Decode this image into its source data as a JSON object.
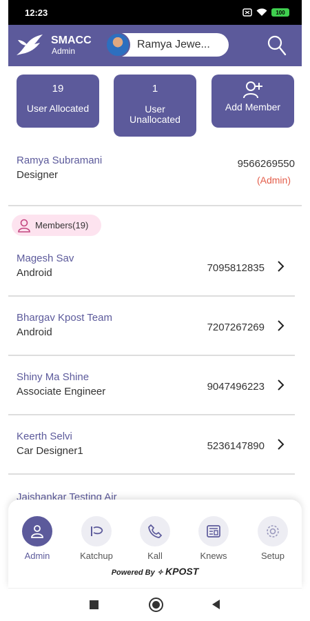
{
  "status": {
    "time": "12:23",
    "battery": "100"
  },
  "header": {
    "app_name": "SMACC",
    "role": "Admin",
    "user_name": "Ramya Jewe..."
  },
  "cards": {
    "allocated": {
      "value": "19",
      "label": "User Allocated"
    },
    "unallocated": {
      "value": "1",
      "label_line1": "User",
      "label_line2": "Unallocated"
    },
    "add_member": {
      "label": "Add Member"
    }
  },
  "admin": {
    "name": "Ramya Subramani",
    "role": "Designer",
    "phone": "9566269550",
    "tag": "(Admin)"
  },
  "members_chip": {
    "label": "Members(19)"
  },
  "members": [
    {
      "name": "Magesh Sav",
      "role": "Android",
      "phone": "7095812835"
    },
    {
      "name": "Bhargav Kpost Team",
      "role": "Android",
      "phone": "7207267269"
    },
    {
      "name": "Shiny Ma Shine",
      "role": "Associate Engineer",
      "phone": "9047496223"
    },
    {
      "name": "Keerth Selvi",
      "role": "Car Designer1",
      "phone": "5236147890"
    }
  ],
  "partial_member": {
    "name": "Jaishankar Testing Air"
  },
  "nav": {
    "items": [
      {
        "label": "Admin",
        "icon": "admin-icon",
        "active": true
      },
      {
        "label": "Katchup",
        "icon": "katchup-icon"
      },
      {
        "label": "Kall",
        "icon": "phone-icon"
      },
      {
        "label": "Knews",
        "icon": "news-icon"
      },
      {
        "label": "Setup",
        "icon": "gear-icon"
      }
    ],
    "powered_by": "Powered By",
    "powered_brand": "KPOST"
  },
  "colors": {
    "primary": "#5c5a9b",
    "accent": "#e35d4a",
    "chip_bg": "#fde3ef"
  }
}
